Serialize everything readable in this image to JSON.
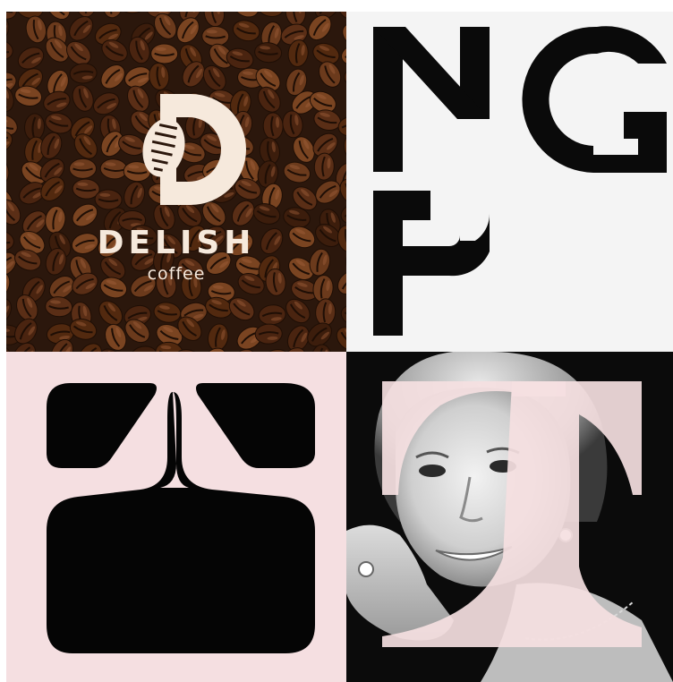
{
  "tiles": {
    "coffee": {
      "brand_name": "DELISH",
      "brand_sub": "coffee",
      "colors": {
        "beans": "#5a2e16",
        "background": "#2b170c",
        "logo": "#f6e9dc"
      }
    },
    "ngp": {
      "colors": {
        "background": "#f4f4f4",
        "letters": "#0a0a0a"
      }
    },
    "shape": {
      "colors": {
        "background": "#f5dfe1",
        "shape": "#050505"
      }
    },
    "portrait": {
      "colors": {
        "background": "#0b0b0b",
        "overlay": "#f5dfe1"
      }
    }
  }
}
